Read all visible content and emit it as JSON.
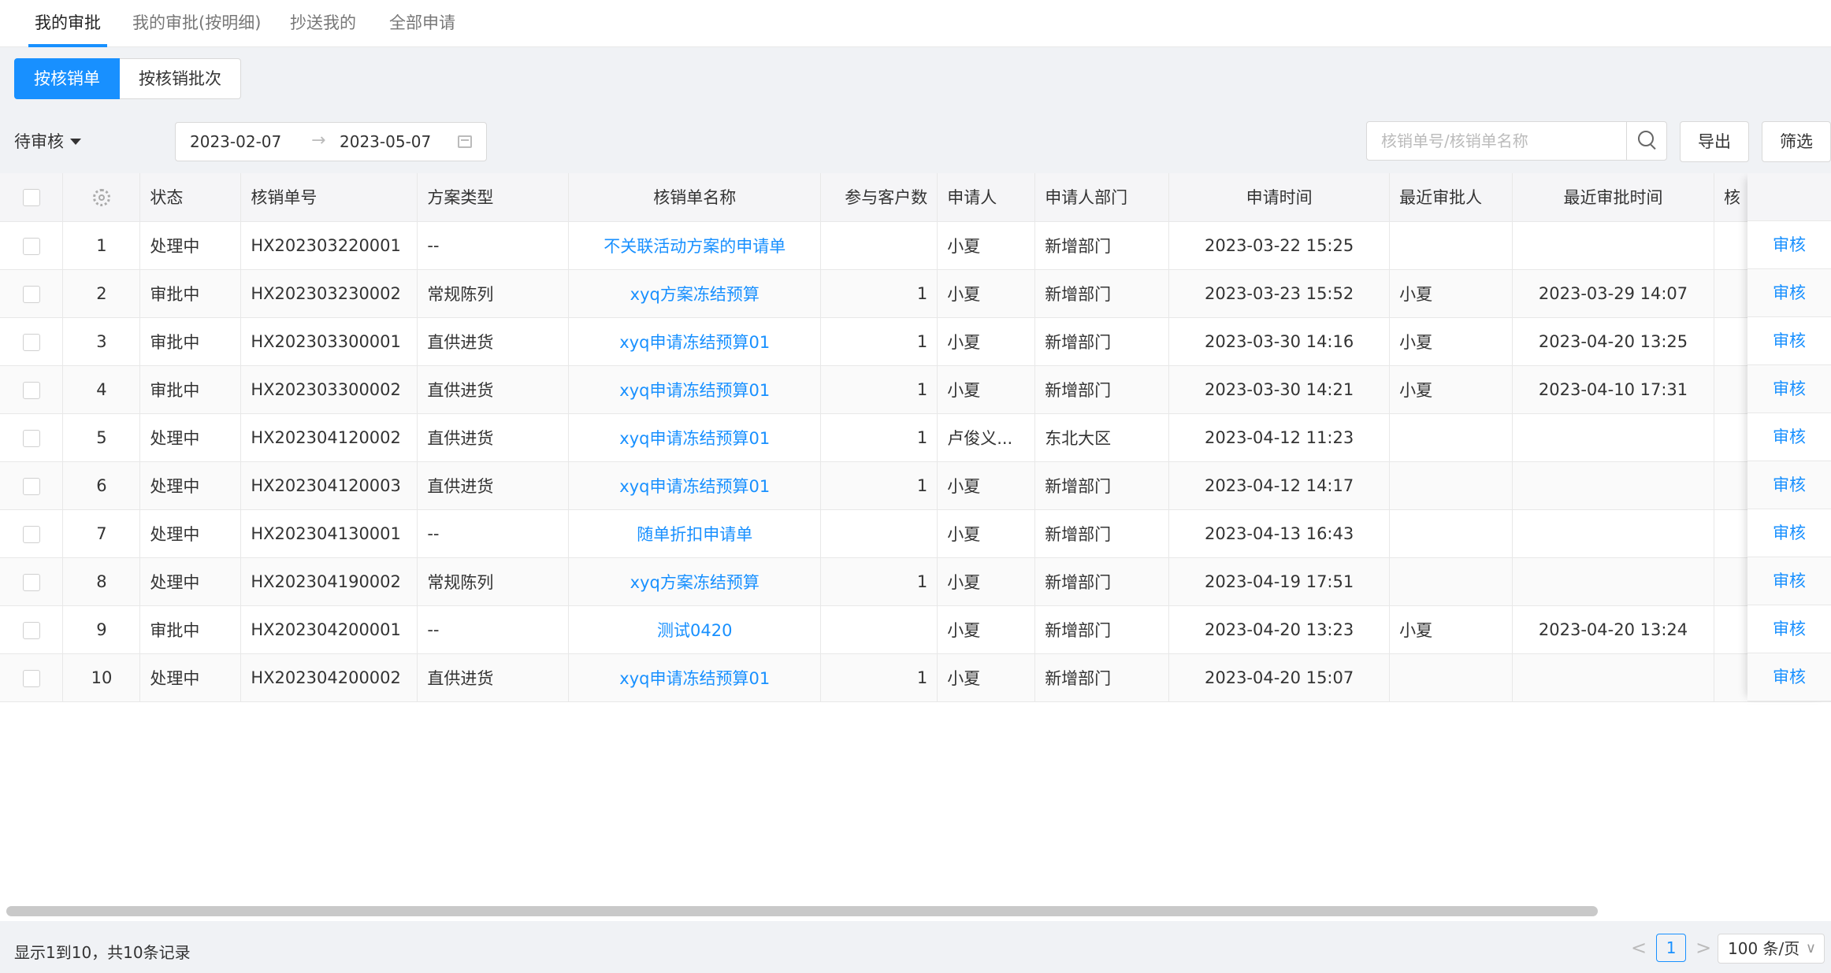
{
  "tabs": [
    {
      "label": "我的审批",
      "active": true
    },
    {
      "label": "我的审批(按明细)",
      "active": false
    },
    {
      "label": "抄送我的",
      "active": false
    },
    {
      "label": "全部申请",
      "active": false
    }
  ],
  "segments": [
    {
      "label": "按核销单",
      "active": true
    },
    {
      "label": "按核销批次",
      "active": false
    }
  ],
  "filters": {
    "status": "待审核",
    "date_start": "2023-02-07",
    "date_sep": "→",
    "date_end": "2023-05-07",
    "search_placeholder": "核销单号/核销单名称",
    "export_label": "导出",
    "filter_label": "筛选"
  },
  "table": {
    "columns": [
      "",
      "",
      "状态",
      "核销单号",
      "方案类型",
      "核销单名称",
      "参与客户数",
      "申请人",
      "申请人部门",
      "申请时间",
      "最近审批人",
      "最近审批时间",
      "核"
    ],
    "action_label": "审核",
    "rows": [
      {
        "no": "1",
        "status": "处理中",
        "code": "HX202303220001",
        "type": "--",
        "name": "不关联活动方案的申请单",
        "customers": "",
        "applicant": "小夏",
        "dept": "新增部门",
        "apply_time": "2023-03-22 15:25",
        "last_approver": "",
        "last_time": ""
      },
      {
        "no": "2",
        "status": "审批中",
        "code": "HX202303230002",
        "type": "常规陈列",
        "name": "xyq方案冻结预算",
        "customers": "1",
        "applicant": "小夏",
        "dept": "新增部门",
        "apply_time": "2023-03-23 15:52",
        "last_approver": "小夏",
        "last_time": "2023-03-29 14:07"
      },
      {
        "no": "3",
        "status": "审批中",
        "code": "HX202303300001",
        "type": "直供进货",
        "name": "xyq申请冻结预算01",
        "customers": "1",
        "applicant": "小夏",
        "dept": "新增部门",
        "apply_time": "2023-03-30 14:16",
        "last_approver": "小夏",
        "last_time": "2023-04-20 13:25"
      },
      {
        "no": "4",
        "status": "审批中",
        "code": "HX202303300002",
        "type": "直供进货",
        "name": "xyq申请冻结预算01",
        "customers": "1",
        "applicant": "小夏",
        "dept": "新增部门",
        "apply_time": "2023-03-30 14:21",
        "last_approver": "小夏",
        "last_time": "2023-04-10 17:31"
      },
      {
        "no": "5",
        "status": "处理中",
        "code": "HX202304120002",
        "type": "直供进货",
        "name": "xyq申请冻结预算01",
        "customers": "1",
        "applicant": "卢俊义...",
        "dept": "东北大区",
        "apply_time": "2023-04-12 11:23",
        "last_approver": "",
        "last_time": ""
      },
      {
        "no": "6",
        "status": "处理中",
        "code": "HX202304120003",
        "type": "直供进货",
        "name": "xyq申请冻结预算01",
        "customers": "1",
        "applicant": "小夏",
        "dept": "新增部门",
        "apply_time": "2023-04-12 14:17",
        "last_approver": "",
        "last_time": ""
      },
      {
        "no": "7",
        "status": "处理中",
        "code": "HX202304130001",
        "type": "--",
        "name": "随单折扣申请单",
        "customers": "",
        "applicant": "小夏",
        "dept": "新增部门",
        "apply_time": "2023-04-13 16:43",
        "last_approver": "",
        "last_time": ""
      },
      {
        "no": "8",
        "status": "处理中",
        "code": "HX202304190002",
        "type": "常规陈列",
        "name": "xyq方案冻结预算",
        "customers": "1",
        "applicant": "小夏",
        "dept": "新增部门",
        "apply_time": "2023-04-19 17:51",
        "last_approver": "",
        "last_time": ""
      },
      {
        "no": "9",
        "status": "审批中",
        "code": "HX202304200001",
        "type": "--",
        "name": "测试0420",
        "customers": "",
        "applicant": "小夏",
        "dept": "新增部门",
        "apply_time": "2023-04-20 13:23",
        "last_approver": "小夏",
        "last_time": "2023-04-20 13:24"
      },
      {
        "no": "10",
        "status": "处理中",
        "code": "HX202304200002",
        "type": "直供进货",
        "name": "xyq申请冻结预算01",
        "customers": "1",
        "applicant": "小夏",
        "dept": "新增部门",
        "apply_time": "2023-04-20 15:07",
        "last_approver": "",
        "last_time": ""
      }
    ]
  },
  "footer": {
    "summary": "显示1到10，共10条记录",
    "prev": "<",
    "page": "1",
    "next": ">",
    "page_size": "100 条/页"
  },
  "colors": {
    "accent": "#1890ff"
  }
}
